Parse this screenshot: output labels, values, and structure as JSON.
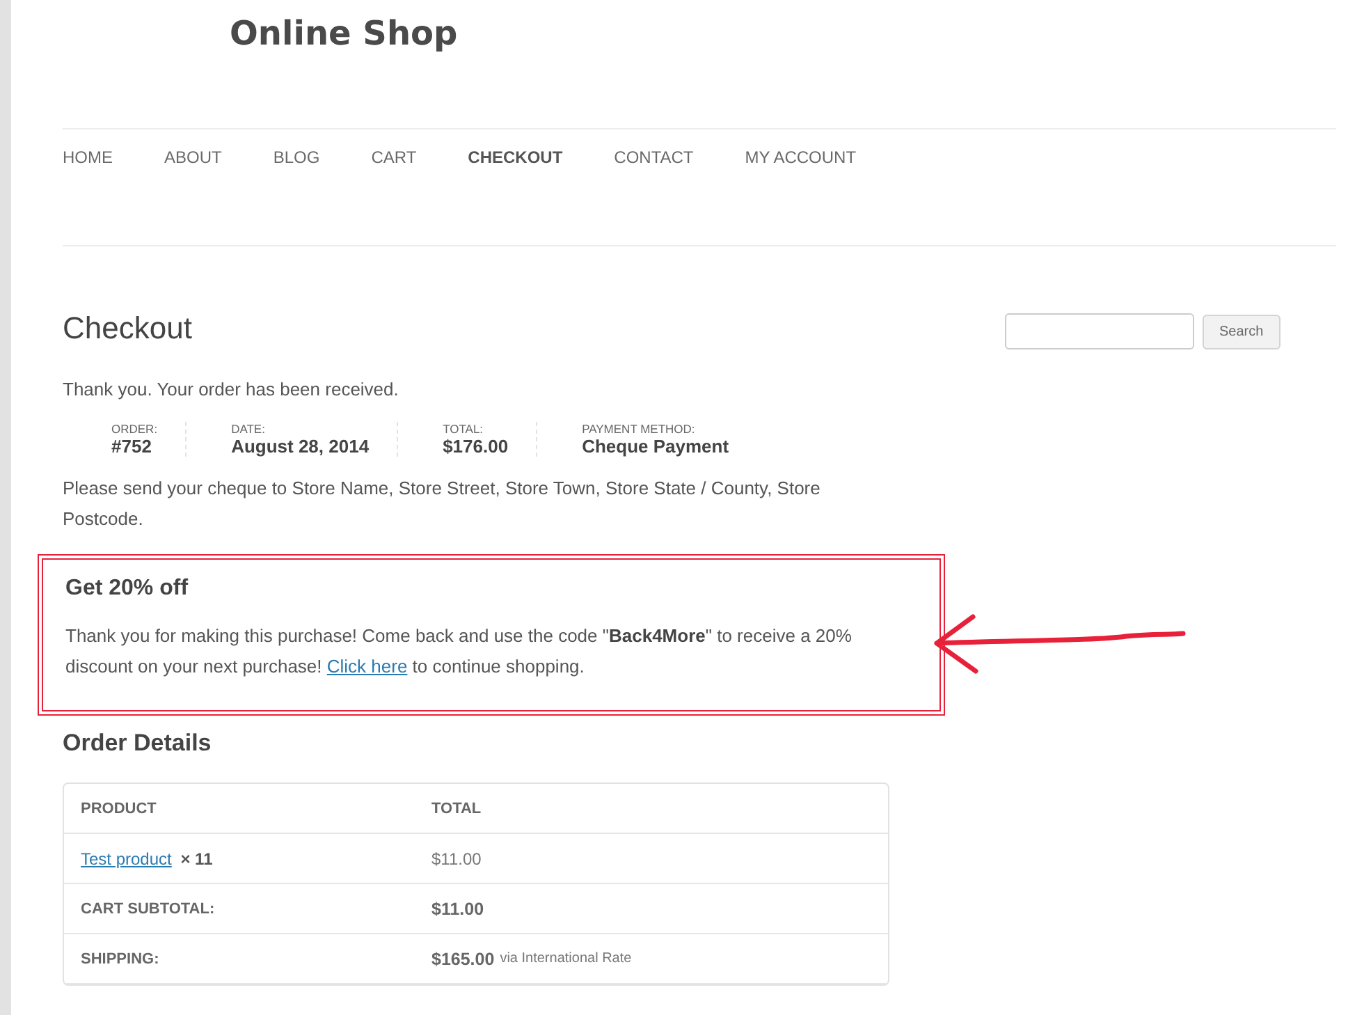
{
  "site_title": "Online Shop",
  "nav": [
    {
      "label": "HOME",
      "selected": false
    },
    {
      "label": "ABOUT",
      "selected": false
    },
    {
      "label": "BLOG",
      "selected": false
    },
    {
      "label": "CART",
      "selected": false
    },
    {
      "label": "CHECKOUT",
      "selected": true
    },
    {
      "label": "CONTACT",
      "selected": false
    },
    {
      "label": "MY ACCOUNT",
      "selected": false
    }
  ],
  "page_title": "Checkout",
  "search": {
    "button": "Search"
  },
  "thank_you": "Thank you. Your order has been received.",
  "order_overview": [
    {
      "label": "ORDER:",
      "value": "#752"
    },
    {
      "label": "DATE:",
      "value": "August 28, 2014"
    },
    {
      "label": "TOTAL:",
      "value": "$176.00"
    },
    {
      "label": "PAYMENT METHOD:",
      "value": "Cheque Payment"
    }
  ],
  "instructions": "Please send your cheque to Store Name, Store Street, Store Town, Store State / County, Store Postcode.",
  "promo": {
    "title": "Get 20% off",
    "text": "Thank you for making this purchase! Come back and use the code \"**Back4More**\" to receive a 20% discount on your next purchase! ",
    "link": "Click here",
    "text_after": " to continue shopping."
  },
  "order_details": {
    "title": "Order Details",
    "columns": [
      "PRODUCT",
      "TOTAL"
    ],
    "rows": [
      {
        "kind": "item",
        "product": "Test product",
        "quantity": "× 11",
        "total": "$11.00"
      },
      {
        "kind": "summary",
        "label": "CART SUBTOTAL:",
        "total": "$11.00"
      },
      {
        "kind": "summary",
        "label": "SHIPPING:",
        "total": "$165.00",
        "note": "via International Rate"
      }
    ]
  }
}
